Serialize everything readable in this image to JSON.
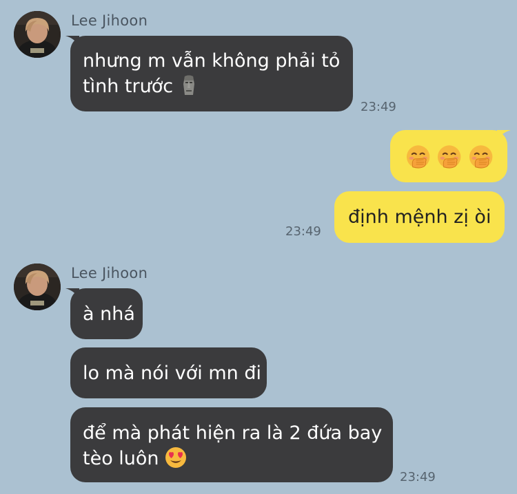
{
  "messages": [
    {
      "sender": "Lee Jihoon",
      "line1": "nhưng m vẫn không phải tỏ",
      "line2": "tình trước",
      "emoji": "moai-emoji",
      "time": "23:49"
    },
    {
      "emoji_row": [
        "face-with-hand-over-mouth-emoji",
        "face-with-hand-over-mouth-emoji",
        "face-with-hand-over-mouth-emoji"
      ]
    },
    {
      "text": "định mệnh zị òi",
      "time": "23:49"
    },
    {
      "sender": "Lee Jihoon",
      "bubbles": [
        {
          "text": "à nhá"
        },
        {
          "text": "lo mà nói với mn đi"
        },
        {
          "line1": "để mà phát hiện ra là 2 đứa bay",
          "line2": "tèo luôn",
          "emoji": "heart-eyes-emoji"
        }
      ],
      "time": "23:49"
    }
  ],
  "colors": {
    "background": "#abc1d1",
    "incoming_bubble": "#3b3b3d",
    "outgoing_bubble": "#f9e34c"
  }
}
